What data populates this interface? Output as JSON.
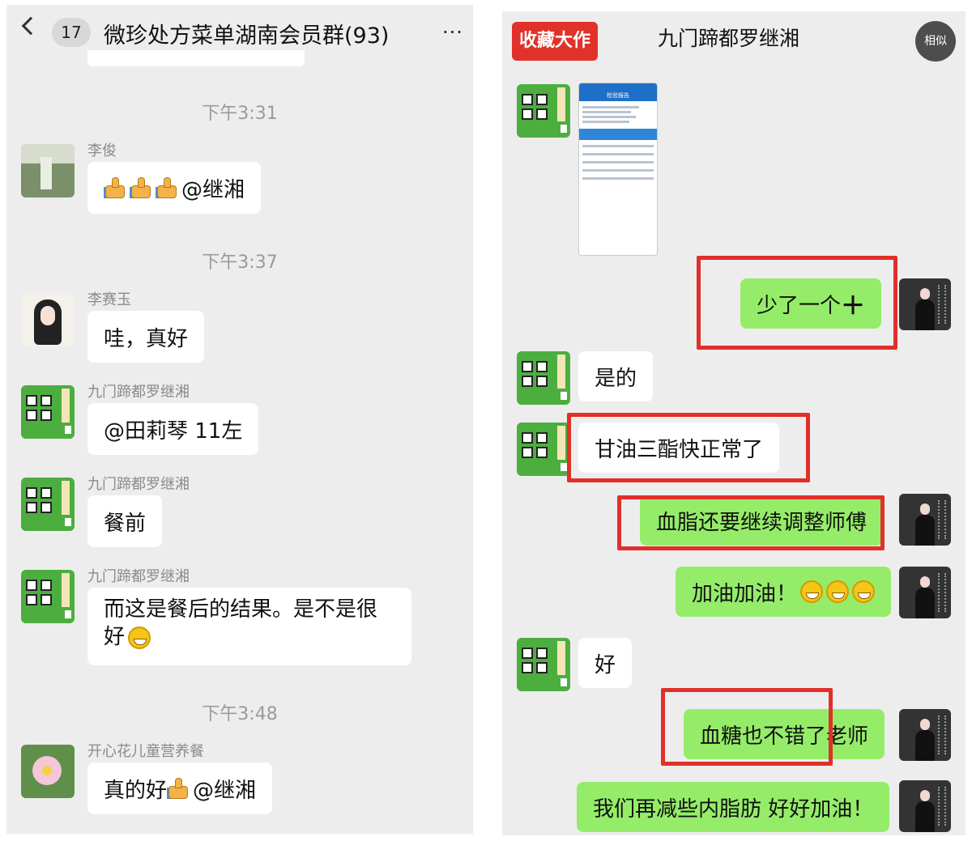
{
  "left": {
    "header": {
      "unread_count": "17",
      "title": "微珍处方菜单湖南会员群(93)",
      "more": "···"
    },
    "messages": [
      {
        "time": "下午3:31",
        "sender": "李俊",
        "text": "@继湘"
      },
      {
        "time": "下午3:37",
        "sender": "李赛玉",
        "text": "哇，真好"
      },
      {
        "sender": "九门蹄都罗继湘",
        "text": "@田莉琴 11左"
      },
      {
        "sender": "九门蹄都罗继湘",
        "text": "餐前"
      },
      {
        "sender": "九门蹄都罗继湘",
        "text": "而这是餐后的结果。是不是很好"
      },
      {
        "time": "下午3:48",
        "sender": "开心花儿童营养餐",
        "text": "真的好",
        "mention": "@继湘"
      }
    ]
  },
  "right": {
    "badge": "收藏大作",
    "title": "九门蹄都罗继湘",
    "similar_button": "相似",
    "screenshot_title": "检验报告",
    "messages": [
      {
        "side": "right",
        "text": "少了一个"
      },
      {
        "side": "left",
        "text": "是的"
      },
      {
        "side": "left",
        "text": "甘油三酯快正常了"
      },
      {
        "side": "right",
        "text": "血脂还要继续调整师傅"
      },
      {
        "side": "right",
        "text": "加油加油！"
      },
      {
        "side": "left",
        "text": "好"
      },
      {
        "side": "right",
        "text": "血糖也不错了老师"
      },
      {
        "side": "right",
        "text": "我们再减些内脂肪 好好加油！"
      }
    ]
  },
  "colors": {
    "chat_bg": "#ededed",
    "bubble_green": "#95ec69",
    "highlight_red": "#e0302a",
    "badge_red": "#e0312a"
  }
}
